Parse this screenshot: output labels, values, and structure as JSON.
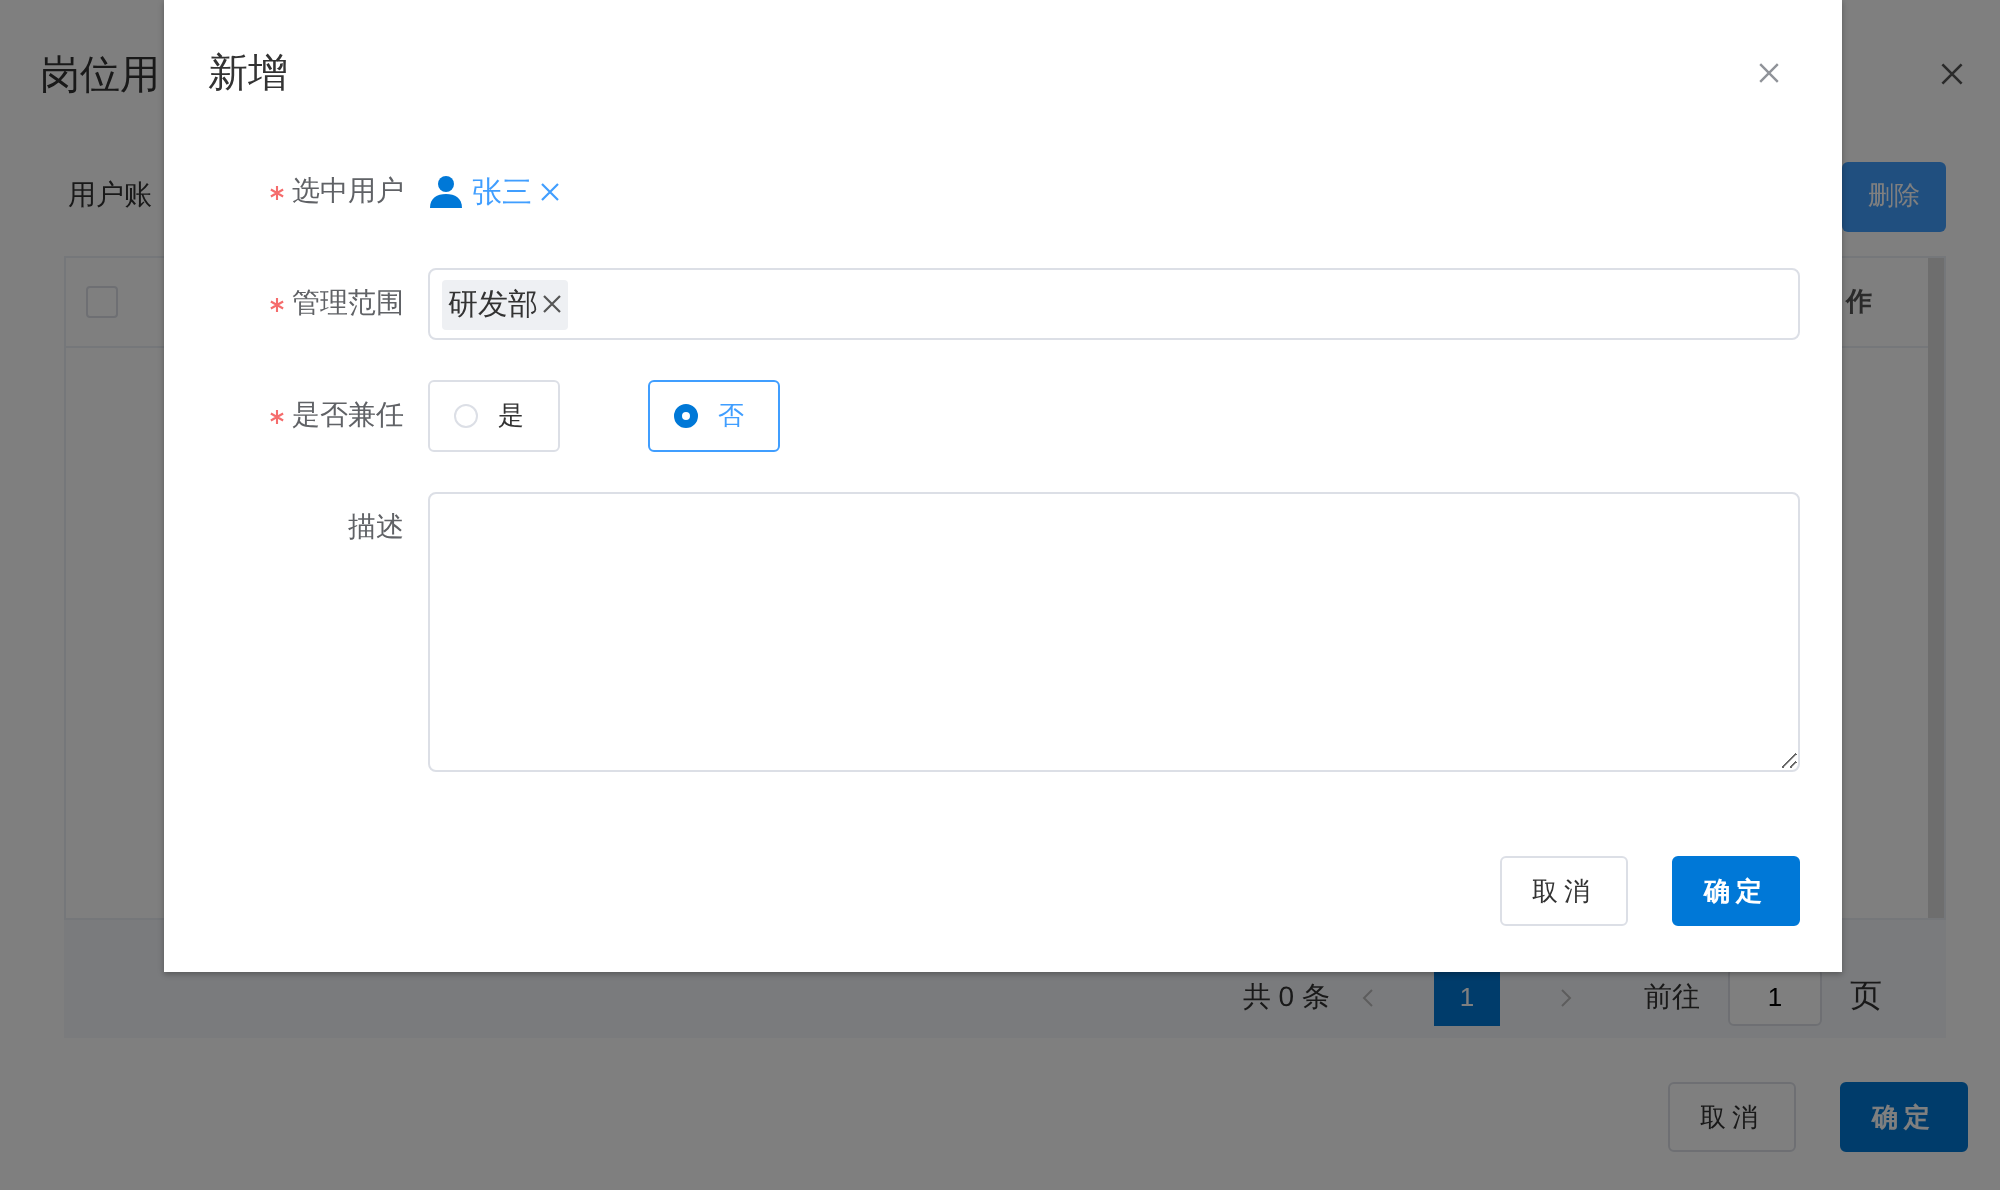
{
  "page": {
    "title": "岗位用",
    "filter_label": "用户账",
    "delete_button": "删除",
    "table": {
      "header_checkbox": {
        "checked": false
      },
      "columns": [
        {
          "label": "作"
        }
      ]
    },
    "pagination": {
      "total": "共 0 条",
      "pages": [
        {
          "label": "1",
          "selected": true
        }
      ],
      "goto_label": "前往",
      "goto_value": "1",
      "page_suffix": "页"
    },
    "buttons": [
      {
        "label": "取消",
        "kind": "default"
      },
      {
        "label": "确定",
        "kind": "primary"
      }
    ]
  },
  "dialog": {
    "title": "新增",
    "fields": [
      {
        "kind": "user",
        "label": "选中用户",
        "required": true,
        "value": "张三"
      },
      {
        "kind": "tags",
        "label": "管理范围",
        "required": true,
        "tags": [
          "研发部"
        ]
      },
      {
        "kind": "radio",
        "label": "是否兼任",
        "required": true,
        "options": [
          {
            "label": "是",
            "selected": false
          },
          {
            "label": "否",
            "selected": true
          }
        ]
      },
      {
        "kind": "textarea",
        "label": "描述",
        "required": false
      }
    ],
    "buttons": [
      {
        "label": "取消",
        "kind": "default"
      },
      {
        "label": "确定",
        "kind": "primary"
      }
    ]
  }
}
